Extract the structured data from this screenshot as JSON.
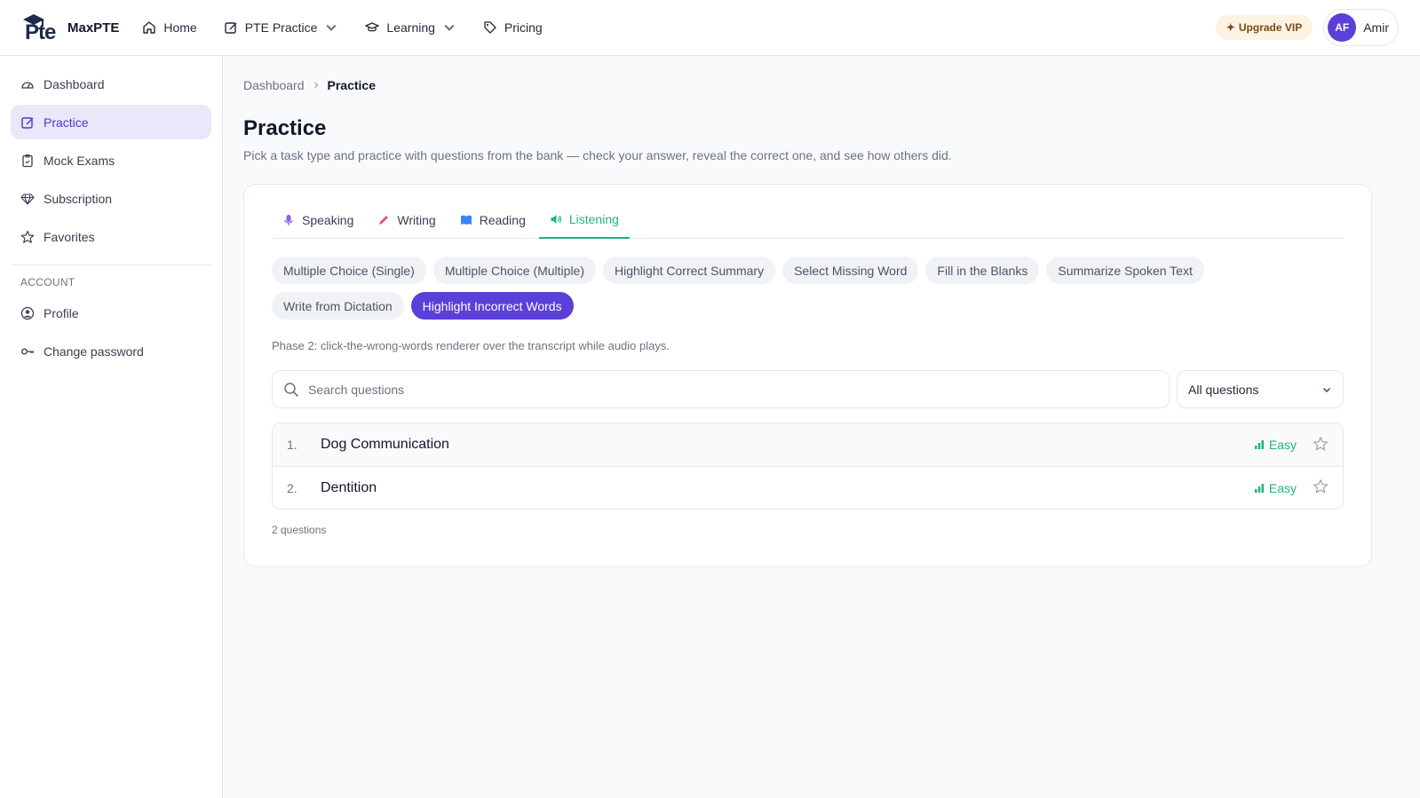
{
  "brand": {
    "logo_text": "Pte",
    "name": "MaxPTE"
  },
  "nav": {
    "home": "Home",
    "pte_practice": "PTE Practice",
    "learning": "Learning",
    "pricing": "Pricing"
  },
  "top_right": {
    "upgrade": "Upgrade VIP",
    "avatar_initials": "AF",
    "user_name": "Amir"
  },
  "sidebar": {
    "items": [
      {
        "label": "Dashboard",
        "icon": "dashboard-icon"
      },
      {
        "label": "Practice",
        "icon": "edit-icon",
        "active": true
      },
      {
        "label": "Mock Exams",
        "icon": "clipboard-icon"
      },
      {
        "label": "Subscription",
        "icon": "diamond-icon"
      },
      {
        "label": "Favorites",
        "icon": "star-icon"
      }
    ],
    "account_section": "ACCOUNT",
    "account_items": [
      {
        "label": "Profile",
        "icon": "user-circle-icon"
      },
      {
        "label": "Change password",
        "icon": "key-icon"
      }
    ]
  },
  "breadcrumb": {
    "root": "Dashboard",
    "current": "Practice"
  },
  "page": {
    "title": "Practice",
    "subtitle": "Pick a task type and practice with questions from the bank — check your answer, reveal the correct one, and see how others did."
  },
  "tabs": [
    {
      "label": "Speaking",
      "icon": "microphone-icon"
    },
    {
      "label": "Writing",
      "icon": "pencil-icon"
    },
    {
      "label": "Reading",
      "icon": "book-icon"
    },
    {
      "label": "Listening",
      "icon": "speaker-icon",
      "active": true
    }
  ],
  "task_types": [
    "Multiple Choice (Single)",
    "Multiple Choice (Multiple)",
    "Highlight Correct Summary",
    "Select Missing Word",
    "Fill in the Blanks",
    "Summarize Spoken Text",
    "Write from Dictation",
    "Highlight Incorrect Words"
  ],
  "active_task_type": "Highlight Incorrect Words",
  "phase_note": "Phase 2: click-the-wrong-words renderer over the transcript while audio plays.",
  "search": {
    "placeholder": "Search questions"
  },
  "filter": {
    "selected": "All questions"
  },
  "questions": [
    {
      "num": "1.",
      "title": "Dog Communication",
      "difficulty": "Easy"
    },
    {
      "num": "2.",
      "title": "Dentition",
      "difficulty": "Easy"
    }
  ],
  "count_text": "2 questions",
  "colors": {
    "accent": "#5b3fd9",
    "listening": "#22b573"
  }
}
